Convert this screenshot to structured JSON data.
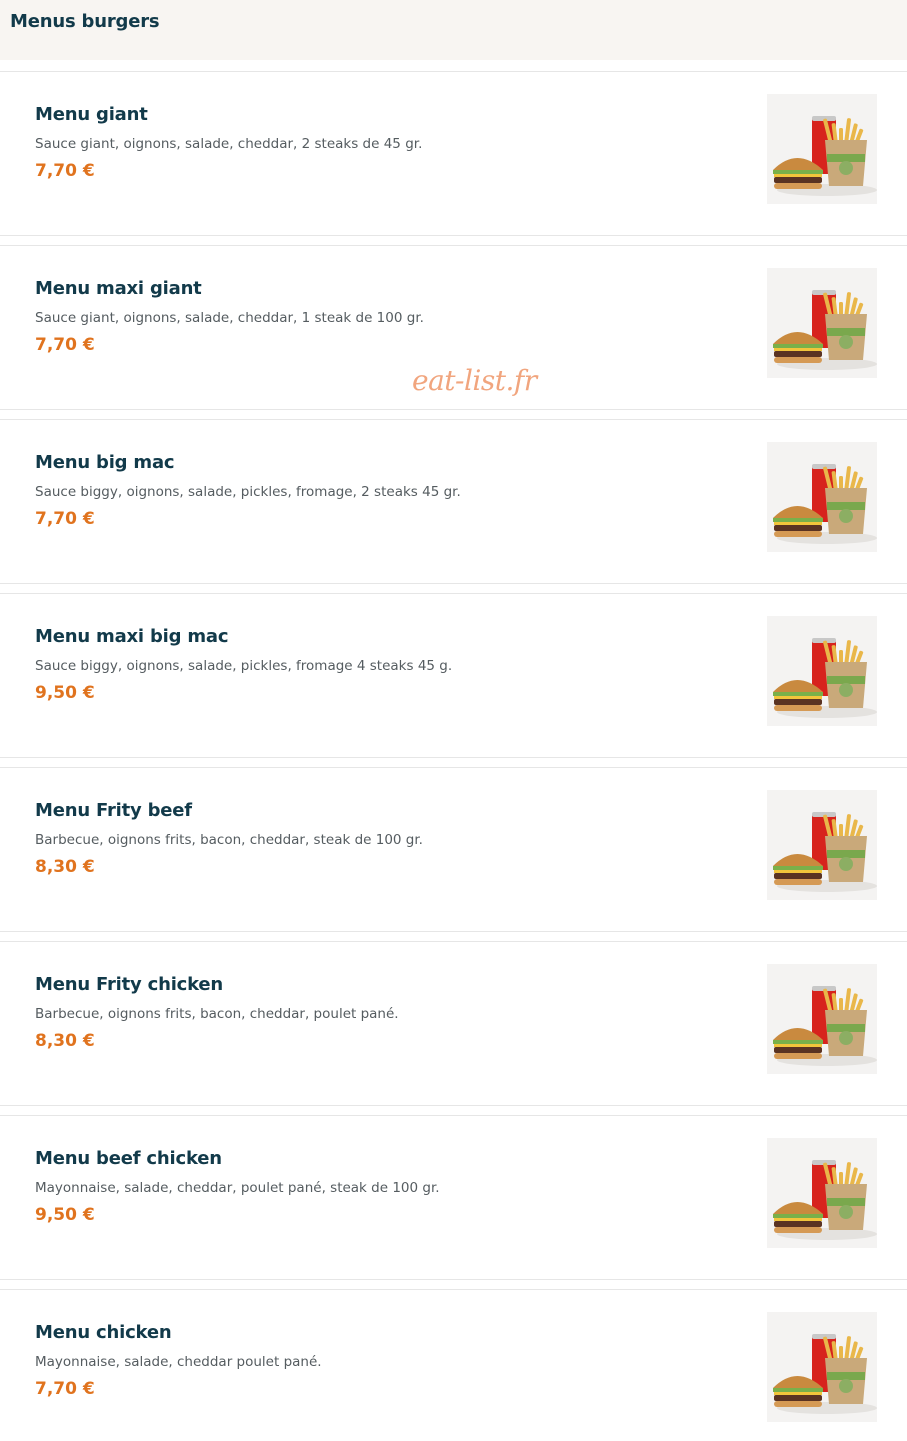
{
  "section": {
    "title": "Menus burgers"
  },
  "watermark": "eat-list.fr",
  "colors": {
    "header_bg": "#f8f5f2",
    "title": "#123a4a",
    "price": "#e0731e",
    "watermark": "#f1a57e"
  },
  "items": [
    {
      "name": "Menu giant",
      "description": "Sauce giant, oignons, salade, cheddar, 2 steaks de 45 gr.",
      "price": "7,70 €",
      "image": "burger-menu-photo"
    },
    {
      "name": "Menu maxi giant",
      "description": "Sauce giant, oignons, salade, cheddar, 1 steak de 100 gr.",
      "price": "7,70 €",
      "image": "burger-menu-photo"
    },
    {
      "name": "Menu big mac",
      "description": "Sauce biggy, oignons, salade, pickles, fromage, 2 steaks 45 gr.",
      "price": "7,70 €",
      "image": "burger-menu-photo"
    },
    {
      "name": "Menu maxi big mac",
      "description": "Sauce biggy, oignons, salade, pickles, fromage 4 steaks 45 g.",
      "price": "9,50 €",
      "image": "burger-menu-photo"
    },
    {
      "name": "Menu Frity beef",
      "description": "Barbecue, oignons frits, bacon, cheddar, steak de 100 gr.",
      "price": "8,30 €",
      "image": "burger-menu-photo"
    },
    {
      "name": "Menu Frity chicken",
      "description": "Barbecue, oignons frits, bacon, cheddar, poulet pané.",
      "price": "8,30 €",
      "image": "burger-menu-photo"
    },
    {
      "name": "Menu beef chicken",
      "description": "Mayonnaise, salade, cheddar, poulet pané, steak de 100 gr.",
      "price": "9,50 €",
      "image": "burger-menu-photo"
    },
    {
      "name": "Menu chicken",
      "description": "Mayonnaise, salade, cheddar poulet pané.",
      "price": "7,70 €",
      "image": "burger-menu-photo"
    }
  ]
}
